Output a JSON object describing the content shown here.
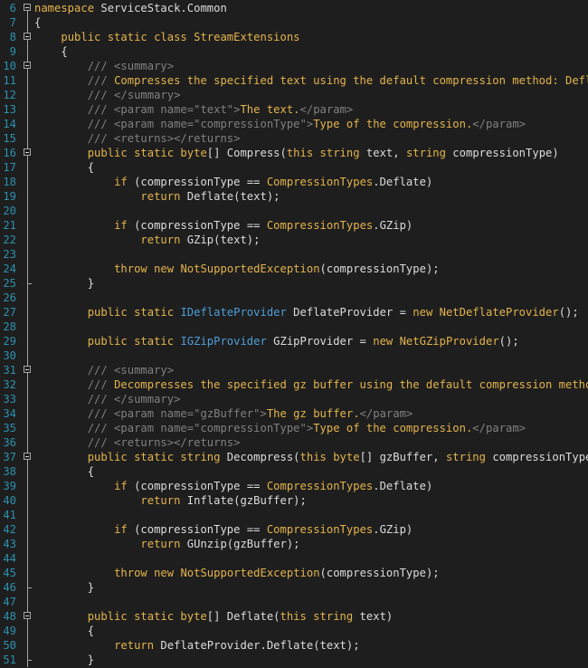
{
  "editor": {
    "lines": [
      {
        "n": "6",
        "fold": "box",
        "tokens": [
          [
            "kw",
            "namespace"
          ],
          [
            "plain",
            " ServiceStack.Common"
          ]
        ]
      },
      {
        "n": "7",
        "fold": "line",
        "tokens": [
          [
            "plain",
            "{"
          ]
        ]
      },
      {
        "n": "8",
        "fold": "box",
        "tokens": [
          [
            "plain",
            "    "
          ],
          [
            "kw",
            "public static class"
          ],
          [
            "plain",
            " "
          ],
          [
            "kw",
            "StreamExtensions"
          ]
        ]
      },
      {
        "n": "9",
        "fold": "line",
        "tokens": [
          [
            "plain",
            "    {"
          ]
        ]
      },
      {
        "n": "10",
        "fold": "box",
        "tokens": [
          [
            "plain",
            "        "
          ],
          [
            "cmt",
            "/// <summary>"
          ]
        ]
      },
      {
        "n": "11",
        "fold": "line",
        "tokens": [
          [
            "plain",
            "        "
          ],
          [
            "cmt",
            "/// "
          ],
          [
            "doc",
            "Compresses the specified text using the default compression method: Deflate"
          ]
        ]
      },
      {
        "n": "12",
        "fold": "line",
        "tokens": [
          [
            "plain",
            "        "
          ],
          [
            "cmt",
            "/// </summary>"
          ]
        ]
      },
      {
        "n": "13",
        "fold": "line",
        "tokens": [
          [
            "plain",
            "        "
          ],
          [
            "cmt",
            "/// <param name=\"text\">"
          ],
          [
            "doc",
            "The text."
          ],
          [
            "cmt",
            "</param>"
          ]
        ]
      },
      {
        "n": "14",
        "fold": "line",
        "tokens": [
          [
            "plain",
            "        "
          ],
          [
            "cmt",
            "/// <param name=\"compressionType\">"
          ],
          [
            "doc",
            "Type of the compression."
          ],
          [
            "cmt",
            "</param>"
          ]
        ]
      },
      {
        "n": "15",
        "fold": "line",
        "tokens": [
          [
            "plain",
            "        "
          ],
          [
            "cmt",
            "/// <returns></returns>"
          ]
        ]
      },
      {
        "n": "16",
        "fold": "box",
        "tokens": [
          [
            "plain",
            "        "
          ],
          [
            "kw",
            "public static byte"
          ],
          [
            "plain",
            "[] Compress("
          ],
          [
            "kw",
            "this string"
          ],
          [
            "plain",
            " text, "
          ],
          [
            "kw",
            "string"
          ],
          [
            "plain",
            " compressionType)"
          ]
        ]
      },
      {
        "n": "17",
        "fold": "line",
        "tokens": [
          [
            "plain",
            "        {"
          ]
        ]
      },
      {
        "n": "18",
        "fold": "line",
        "tokens": [
          [
            "plain",
            "            "
          ],
          [
            "kw",
            "if"
          ],
          [
            "plain",
            " (compressionType == "
          ],
          [
            "kw",
            "CompressionTypes"
          ],
          [
            "plain",
            ".Deflate)"
          ]
        ]
      },
      {
        "n": "19",
        "fold": "line",
        "tokens": [
          [
            "plain",
            "                "
          ],
          [
            "kw",
            "return"
          ],
          [
            "plain",
            " Deflate(text);"
          ]
        ]
      },
      {
        "n": "20",
        "fold": "line",
        "tokens": [
          [
            "plain",
            ""
          ]
        ]
      },
      {
        "n": "21",
        "fold": "line",
        "tokens": [
          [
            "plain",
            "            "
          ],
          [
            "kw",
            "if"
          ],
          [
            "plain",
            " (compressionType == "
          ],
          [
            "kw",
            "CompressionTypes"
          ],
          [
            "plain",
            ".GZip)"
          ]
        ]
      },
      {
        "n": "22",
        "fold": "line",
        "tokens": [
          [
            "plain",
            "                "
          ],
          [
            "kw",
            "return"
          ],
          [
            "plain",
            " GZip(text);"
          ]
        ]
      },
      {
        "n": "23",
        "fold": "line",
        "tokens": [
          [
            "plain",
            ""
          ]
        ]
      },
      {
        "n": "24",
        "fold": "line",
        "tokens": [
          [
            "plain",
            "            "
          ],
          [
            "kw",
            "throw new"
          ],
          [
            "plain",
            " "
          ],
          [
            "kw",
            "NotSupportedException"
          ],
          [
            "plain",
            "(compressionType);"
          ]
        ]
      },
      {
        "n": "25",
        "fold": "end",
        "tokens": [
          [
            "plain",
            "        }"
          ]
        ]
      },
      {
        "n": "26",
        "fold": "line",
        "tokens": [
          [
            "plain",
            ""
          ]
        ]
      },
      {
        "n": "27",
        "fold": "line",
        "tokens": [
          [
            "plain",
            "        "
          ],
          [
            "kw",
            "public static"
          ],
          [
            "plain",
            " "
          ],
          [
            "type",
            "IDeflateProvider"
          ],
          [
            "plain",
            " DeflateProvider = "
          ],
          [
            "kw",
            "new"
          ],
          [
            "plain",
            " "
          ],
          [
            "kw",
            "NetDeflateProvider"
          ],
          [
            "plain",
            "();"
          ]
        ]
      },
      {
        "n": "28",
        "fold": "line",
        "tokens": [
          [
            "plain",
            ""
          ]
        ]
      },
      {
        "n": "29",
        "fold": "line",
        "tokens": [
          [
            "plain",
            "        "
          ],
          [
            "kw",
            "public static"
          ],
          [
            "plain",
            " "
          ],
          [
            "type",
            "IGZipProvider"
          ],
          [
            "plain",
            " GZipProvider = "
          ],
          [
            "kw",
            "new"
          ],
          [
            "plain",
            " "
          ],
          [
            "kw",
            "NetGZipProvider"
          ],
          [
            "plain",
            "();"
          ]
        ]
      },
      {
        "n": "30",
        "fold": "line",
        "tokens": [
          [
            "plain",
            ""
          ]
        ]
      },
      {
        "n": "31",
        "fold": "box",
        "tokens": [
          [
            "plain",
            "        "
          ],
          [
            "cmt",
            "/// <summary>"
          ]
        ]
      },
      {
        "n": "32",
        "fold": "line",
        "tokens": [
          [
            "plain",
            "        "
          ],
          [
            "cmt",
            "/// "
          ],
          [
            "doc",
            "Decompresses the specified gz buffer using the default compression method"
          ]
        ]
      },
      {
        "n": "33",
        "fold": "line",
        "tokens": [
          [
            "plain",
            "        "
          ],
          [
            "cmt",
            "/// </summary>"
          ]
        ]
      },
      {
        "n": "34",
        "fold": "line",
        "tokens": [
          [
            "plain",
            "        "
          ],
          [
            "cmt",
            "/// <param name=\"gzBuffer\">"
          ],
          [
            "doc",
            "The gz buffer."
          ],
          [
            "cmt",
            "</param>"
          ]
        ]
      },
      {
        "n": "35",
        "fold": "line",
        "tokens": [
          [
            "plain",
            "        "
          ],
          [
            "cmt",
            "/// <param name=\"compressionType\">"
          ],
          [
            "doc",
            "Type of the compression."
          ],
          [
            "cmt",
            "</param>"
          ]
        ]
      },
      {
        "n": "36",
        "fold": "line",
        "tokens": [
          [
            "plain",
            "        "
          ],
          [
            "cmt",
            "/// <returns></returns>"
          ]
        ]
      },
      {
        "n": "37",
        "fold": "box",
        "tokens": [
          [
            "plain",
            "        "
          ],
          [
            "kw",
            "public static string"
          ],
          [
            "plain",
            " Decompress("
          ],
          [
            "kw",
            "this byte"
          ],
          [
            "plain",
            "[] gzBuffer, "
          ],
          [
            "kw",
            "string"
          ],
          [
            "plain",
            " compressionType)"
          ]
        ]
      },
      {
        "n": "38",
        "fold": "line",
        "tokens": [
          [
            "plain",
            "        {"
          ]
        ]
      },
      {
        "n": "39",
        "fold": "line",
        "tokens": [
          [
            "plain",
            "            "
          ],
          [
            "kw",
            "if"
          ],
          [
            "plain",
            " (compressionType == "
          ],
          [
            "kw",
            "CompressionTypes"
          ],
          [
            "plain",
            ".Deflate)"
          ]
        ]
      },
      {
        "n": "40",
        "fold": "line",
        "tokens": [
          [
            "plain",
            "                "
          ],
          [
            "kw",
            "return"
          ],
          [
            "plain",
            " Inflate(gzBuffer);"
          ]
        ]
      },
      {
        "n": "41",
        "fold": "line",
        "tokens": [
          [
            "plain",
            ""
          ]
        ]
      },
      {
        "n": "42",
        "fold": "line",
        "tokens": [
          [
            "plain",
            "            "
          ],
          [
            "kw",
            "if"
          ],
          [
            "plain",
            " (compressionType == "
          ],
          [
            "kw",
            "CompressionTypes"
          ],
          [
            "plain",
            ".GZip)"
          ]
        ]
      },
      {
        "n": "43",
        "fold": "line",
        "tokens": [
          [
            "plain",
            "                "
          ],
          [
            "kw",
            "return"
          ],
          [
            "plain",
            " GUnzip(gzBuffer);"
          ]
        ]
      },
      {
        "n": "44",
        "fold": "line",
        "tokens": [
          [
            "plain",
            ""
          ]
        ]
      },
      {
        "n": "45",
        "fold": "line",
        "tokens": [
          [
            "plain",
            "            "
          ],
          [
            "kw",
            "throw new"
          ],
          [
            "plain",
            " "
          ],
          [
            "kw",
            "NotSupportedException"
          ],
          [
            "plain",
            "(compressionType);"
          ]
        ]
      },
      {
        "n": "46",
        "fold": "end",
        "tokens": [
          [
            "plain",
            "        }"
          ]
        ]
      },
      {
        "n": "47",
        "fold": "line",
        "tokens": [
          [
            "plain",
            ""
          ]
        ]
      },
      {
        "n": "48",
        "fold": "box",
        "tokens": [
          [
            "plain",
            "        "
          ],
          [
            "kw",
            "public static byte"
          ],
          [
            "plain",
            "[] Deflate("
          ],
          [
            "kw",
            "this string"
          ],
          [
            "plain",
            " text)"
          ]
        ]
      },
      {
        "n": "49",
        "fold": "line",
        "tokens": [
          [
            "plain",
            "        {"
          ]
        ]
      },
      {
        "n": "50",
        "fold": "line",
        "tokens": [
          [
            "plain",
            "            "
          ],
          [
            "kw",
            "return"
          ],
          [
            "plain",
            " DeflateProvider.Deflate(text);"
          ]
        ]
      },
      {
        "n": "51",
        "fold": "end",
        "tokens": [
          [
            "plain",
            "        }"
          ]
        ]
      }
    ]
  },
  "colors": {
    "background": "#1e1e1e",
    "line_number": "#2b91af",
    "keyword": "#e4b44c",
    "interface_type": "#4e9ed8",
    "comment": "#808080",
    "plain": "#dcdcdc"
  }
}
